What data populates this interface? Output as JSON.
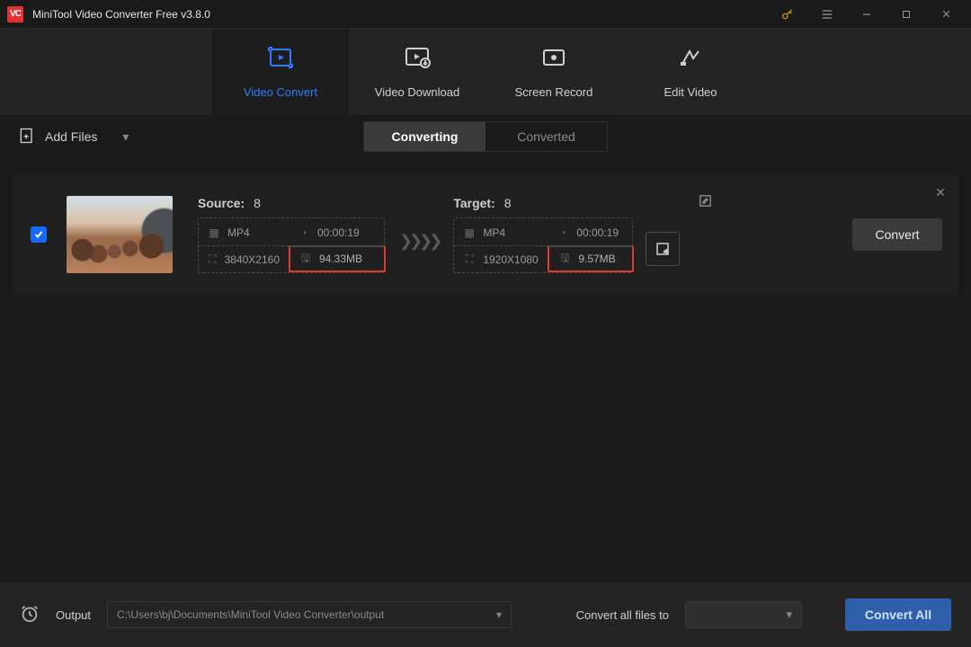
{
  "title": "MiniTool Video Converter Free v3.8.0",
  "logo_text": "VC",
  "tabs": {
    "convert": "Video Convert",
    "download": "Video Download",
    "record": "Screen Record",
    "edit": "Edit Video"
  },
  "toolbar": {
    "add_files": "Add Files",
    "seg_converting": "Converting",
    "seg_converted": "Converted"
  },
  "item": {
    "source_label": "Source:",
    "source_id": "8",
    "src_fmt": "MP4",
    "src_dur": "00:00:19",
    "src_res": "3840X2160",
    "src_size": "94.33MB",
    "target_label": "Target:",
    "target_id": "8",
    "tgt_fmt": "MP4",
    "tgt_dur": "00:00:19",
    "tgt_res": "1920X1080",
    "tgt_size": "9.57MB",
    "arrows": "❯❯❯❯",
    "convert_label": "Convert"
  },
  "bottom": {
    "output_label": "Output",
    "output_path": "C:\\Users\\bj\\Documents\\MiniTool Video Converter\\output",
    "allfiles_label": "Convert all files to",
    "convert_all_label": "Convert All"
  }
}
